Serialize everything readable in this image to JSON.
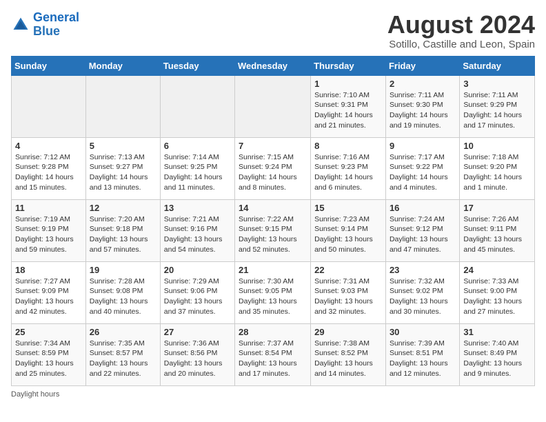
{
  "header": {
    "logo_line1": "General",
    "logo_line2": "Blue",
    "month_year": "August 2024",
    "location": "Sotillo, Castille and Leon, Spain"
  },
  "days_of_week": [
    "Sunday",
    "Monday",
    "Tuesday",
    "Wednesday",
    "Thursday",
    "Friday",
    "Saturday"
  ],
  "weeks": [
    [
      {
        "day": "",
        "info": ""
      },
      {
        "day": "",
        "info": ""
      },
      {
        "day": "",
        "info": ""
      },
      {
        "day": "",
        "info": ""
      },
      {
        "day": "1",
        "info": "Sunrise: 7:10 AM\nSunset: 9:31 PM\nDaylight: 14 hours and 21 minutes."
      },
      {
        "day": "2",
        "info": "Sunrise: 7:11 AM\nSunset: 9:30 PM\nDaylight: 14 hours and 19 minutes."
      },
      {
        "day": "3",
        "info": "Sunrise: 7:11 AM\nSunset: 9:29 PM\nDaylight: 14 hours and 17 minutes."
      }
    ],
    [
      {
        "day": "4",
        "info": "Sunrise: 7:12 AM\nSunset: 9:28 PM\nDaylight: 14 hours and 15 minutes."
      },
      {
        "day": "5",
        "info": "Sunrise: 7:13 AM\nSunset: 9:27 PM\nDaylight: 14 hours and 13 minutes."
      },
      {
        "day": "6",
        "info": "Sunrise: 7:14 AM\nSunset: 9:25 PM\nDaylight: 14 hours and 11 minutes."
      },
      {
        "day": "7",
        "info": "Sunrise: 7:15 AM\nSunset: 9:24 PM\nDaylight: 14 hours and 8 minutes."
      },
      {
        "day": "8",
        "info": "Sunrise: 7:16 AM\nSunset: 9:23 PM\nDaylight: 14 hours and 6 minutes."
      },
      {
        "day": "9",
        "info": "Sunrise: 7:17 AM\nSunset: 9:22 PM\nDaylight: 14 hours and 4 minutes."
      },
      {
        "day": "10",
        "info": "Sunrise: 7:18 AM\nSunset: 9:20 PM\nDaylight: 14 hours and 1 minute."
      }
    ],
    [
      {
        "day": "11",
        "info": "Sunrise: 7:19 AM\nSunset: 9:19 PM\nDaylight: 13 hours and 59 minutes."
      },
      {
        "day": "12",
        "info": "Sunrise: 7:20 AM\nSunset: 9:18 PM\nDaylight: 13 hours and 57 minutes."
      },
      {
        "day": "13",
        "info": "Sunrise: 7:21 AM\nSunset: 9:16 PM\nDaylight: 13 hours and 54 minutes."
      },
      {
        "day": "14",
        "info": "Sunrise: 7:22 AM\nSunset: 9:15 PM\nDaylight: 13 hours and 52 minutes."
      },
      {
        "day": "15",
        "info": "Sunrise: 7:23 AM\nSunset: 9:14 PM\nDaylight: 13 hours and 50 minutes."
      },
      {
        "day": "16",
        "info": "Sunrise: 7:24 AM\nSunset: 9:12 PM\nDaylight: 13 hours and 47 minutes."
      },
      {
        "day": "17",
        "info": "Sunrise: 7:26 AM\nSunset: 9:11 PM\nDaylight: 13 hours and 45 minutes."
      }
    ],
    [
      {
        "day": "18",
        "info": "Sunrise: 7:27 AM\nSunset: 9:09 PM\nDaylight: 13 hours and 42 minutes."
      },
      {
        "day": "19",
        "info": "Sunrise: 7:28 AM\nSunset: 9:08 PM\nDaylight: 13 hours and 40 minutes."
      },
      {
        "day": "20",
        "info": "Sunrise: 7:29 AM\nSunset: 9:06 PM\nDaylight: 13 hours and 37 minutes."
      },
      {
        "day": "21",
        "info": "Sunrise: 7:30 AM\nSunset: 9:05 PM\nDaylight: 13 hours and 35 minutes."
      },
      {
        "day": "22",
        "info": "Sunrise: 7:31 AM\nSunset: 9:03 PM\nDaylight: 13 hours and 32 minutes."
      },
      {
        "day": "23",
        "info": "Sunrise: 7:32 AM\nSunset: 9:02 PM\nDaylight: 13 hours and 30 minutes."
      },
      {
        "day": "24",
        "info": "Sunrise: 7:33 AM\nSunset: 9:00 PM\nDaylight: 13 hours and 27 minutes."
      }
    ],
    [
      {
        "day": "25",
        "info": "Sunrise: 7:34 AM\nSunset: 8:59 PM\nDaylight: 13 hours and 25 minutes."
      },
      {
        "day": "26",
        "info": "Sunrise: 7:35 AM\nSunset: 8:57 PM\nDaylight: 13 hours and 22 minutes."
      },
      {
        "day": "27",
        "info": "Sunrise: 7:36 AM\nSunset: 8:56 PM\nDaylight: 13 hours and 20 minutes."
      },
      {
        "day": "28",
        "info": "Sunrise: 7:37 AM\nSunset: 8:54 PM\nDaylight: 13 hours and 17 minutes."
      },
      {
        "day": "29",
        "info": "Sunrise: 7:38 AM\nSunset: 8:52 PM\nDaylight: 13 hours and 14 minutes."
      },
      {
        "day": "30",
        "info": "Sunrise: 7:39 AM\nSunset: 8:51 PM\nDaylight: 13 hours and 12 minutes."
      },
      {
        "day": "31",
        "info": "Sunrise: 7:40 AM\nSunset: 8:49 PM\nDaylight: 13 hours and 9 minutes."
      }
    ]
  ],
  "footer": {
    "daylight_label": "Daylight hours"
  }
}
